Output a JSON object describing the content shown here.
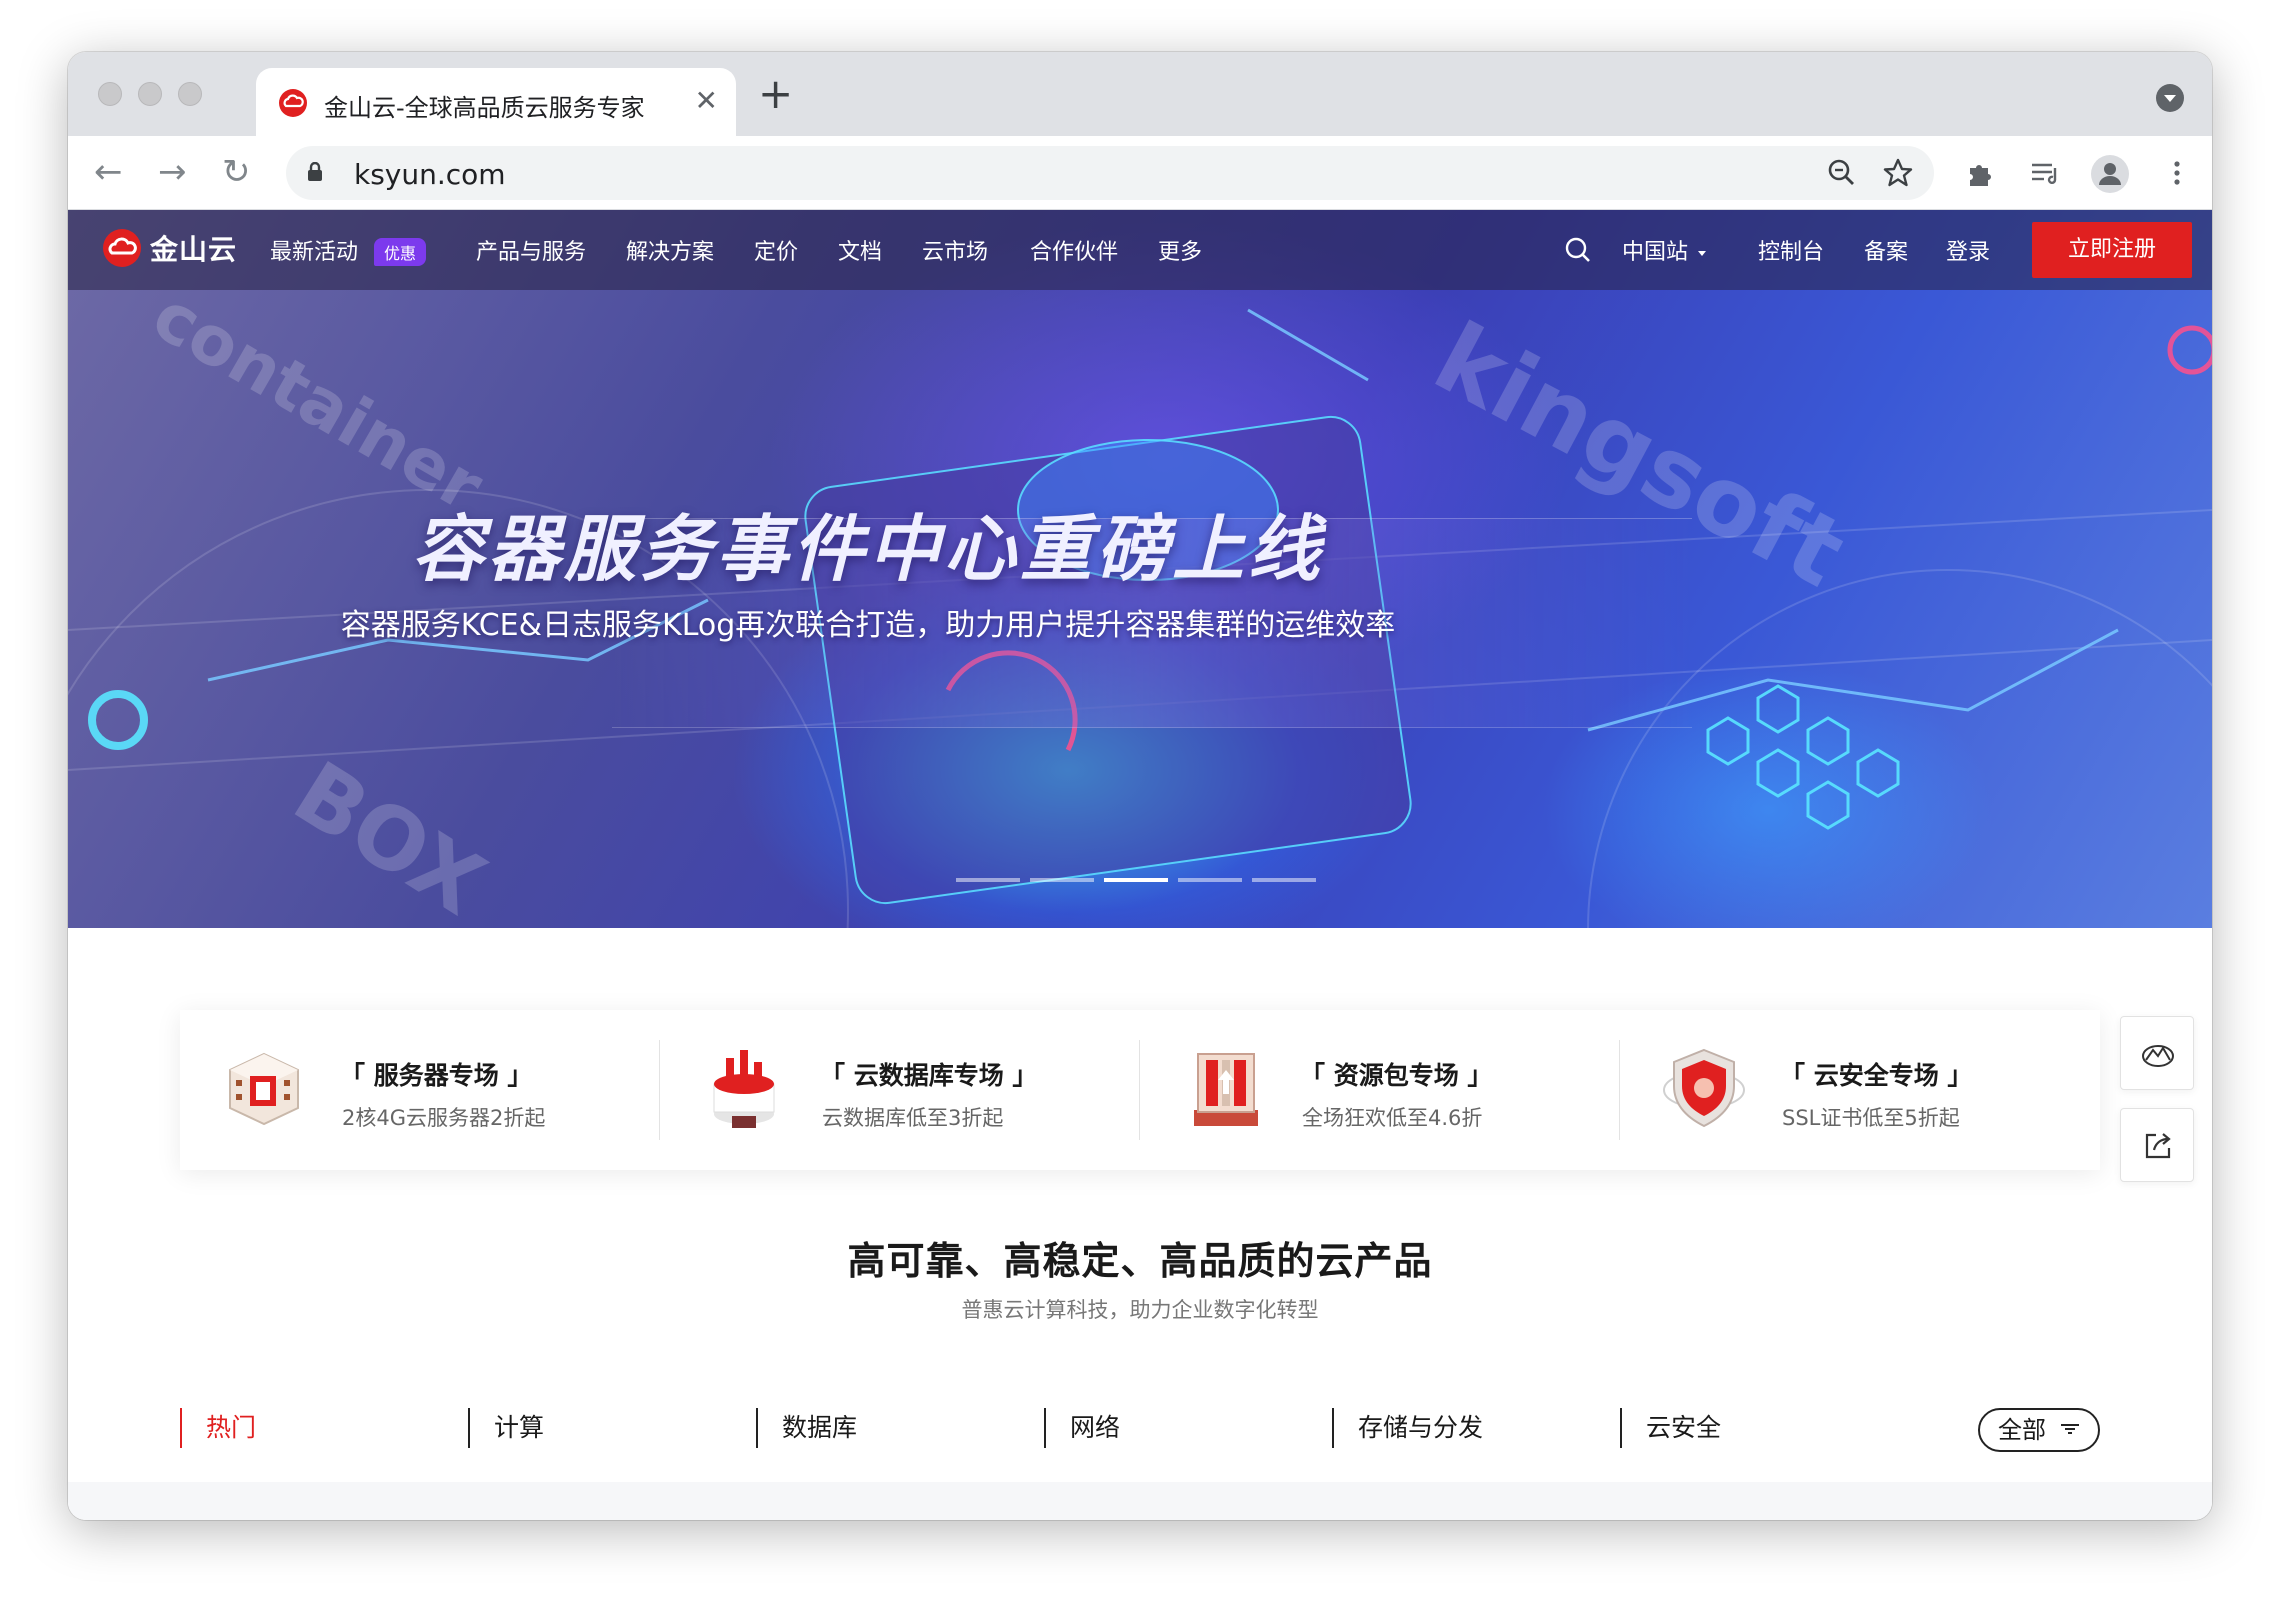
{
  "browser": {
    "tab_title": "金山云-全球高品质云服务专家",
    "tab_close": "✕",
    "new_tab": "+",
    "url": "ksyun.com"
  },
  "site": {
    "brand": "金山云",
    "nav": [
      {
        "label": "最新活动"
      },
      {
        "label": "产品与服务"
      },
      {
        "label": "解决方案"
      },
      {
        "label": "定价"
      },
      {
        "label": "文档"
      },
      {
        "label": "云市场"
      },
      {
        "label": "合作伙伴"
      },
      {
        "label": "更多"
      }
    ],
    "promo_badge": "优惠",
    "region": "中国站",
    "console": "控制台",
    "filing": "备案",
    "login": "登录",
    "register": "立即注册",
    "accent_color": "#e02020"
  },
  "hero": {
    "title": "容器服务事件中心重磅上线",
    "subtitle": "容器服务KCE&日志服务KLog再次联合打造，助力用户提升容器集群的运维效率",
    "slide_count": 5,
    "active_slide": 3
  },
  "promos": [
    {
      "title": "「 服务器专场 」",
      "desc": "2核4G云服务器2折起",
      "icon": "server-icon"
    },
    {
      "title": "「 云数据库专场 」",
      "desc": "云数据库低至3折起",
      "icon": "database-icon"
    },
    {
      "title": "「 资源包专场 」",
      "desc": "全场狂欢低至4.6折",
      "icon": "resource-pack-icon"
    },
    {
      "title": "「 云安全专场 」",
      "desc": "SSL证书低至5折起",
      "icon": "shield-icon"
    }
  ],
  "products": {
    "title": "高可靠、高稳定、高品质的云产品",
    "subtitle": "普惠云计算科技，助力企业数字化转型",
    "tabs": [
      "热门",
      "计算",
      "数据库",
      "网络",
      "存储与分发",
      "云安全"
    ],
    "active_tab": "热门",
    "all_label": "全部"
  }
}
